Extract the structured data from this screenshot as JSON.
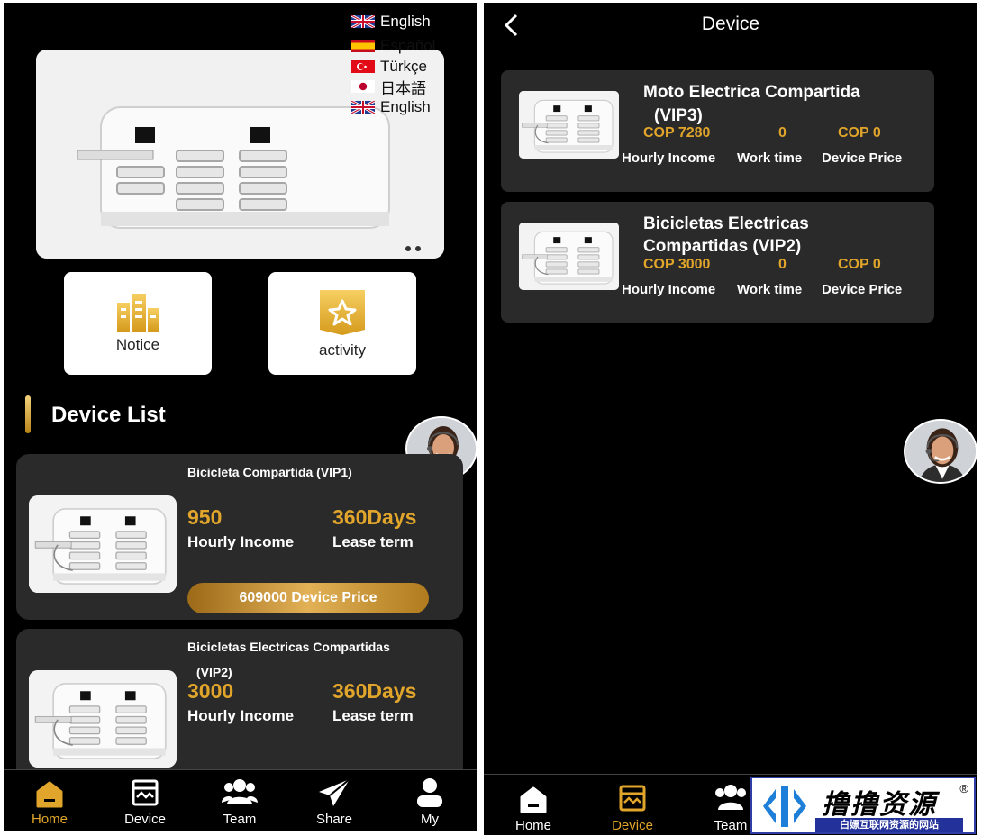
{
  "left": {
    "languages": [
      {
        "label": "English",
        "flag": "uk"
      },
      {
        "label": "Español",
        "flag": "es"
      },
      {
        "label": "Türkçe",
        "flag": "tr"
      },
      {
        "label": "日本語",
        "flag": "jp"
      },
      {
        "label": "English",
        "flag": "uk"
      }
    ],
    "tiles": {
      "notice": "Notice",
      "activity": "activity"
    },
    "section_title": "Device List",
    "cards": [
      {
        "name": "Bicicleta Compartida  (VIP1)",
        "income": "950",
        "income_label": "Hourly Income",
        "term": "360Days",
        "term_label": "Lease term",
        "price_button": "609000 Device Price"
      },
      {
        "name": "Bicicletas Electricas Compartidas",
        "name_line2": "(VIP2)",
        "income": "3000",
        "income_label": "Hourly Income",
        "term": "360Days",
        "term_label": "Lease term"
      }
    ],
    "tabs": [
      "Home",
      "Device",
      "Team",
      "Share",
      "My"
    ],
    "active_tab": "Home"
  },
  "right": {
    "title": "Device",
    "devices": [
      {
        "name_line1": "Moto Electrica Compartida",
        "name_line2": "(VIP3)",
        "income": "COP 7280",
        "work": "0",
        "price": "COP 0",
        "income_label": "Hourly Income",
        "work_label": "Work time",
        "price_label": "Device Price"
      },
      {
        "name_line1": "Bicicletas Electricas",
        "name_line2": "Compartidas  (VIP2)",
        "income": "COP 3000",
        "work": "0",
        "price": "COP 0",
        "income_label": "Hourly Income",
        "work_label": "Work time",
        "price_label": "Device Price"
      }
    ],
    "tabs": [
      "Home",
      "Device",
      "Team"
    ],
    "active_tab": "Device"
  },
  "watermark": {
    "main": "撸撸资源",
    "sub": "白嫖互联网资源的网站",
    "reg": "®"
  },
  "colors": {
    "gold": "#e0a52a",
    "background": "#000000",
    "card": "#2a2a2a"
  }
}
